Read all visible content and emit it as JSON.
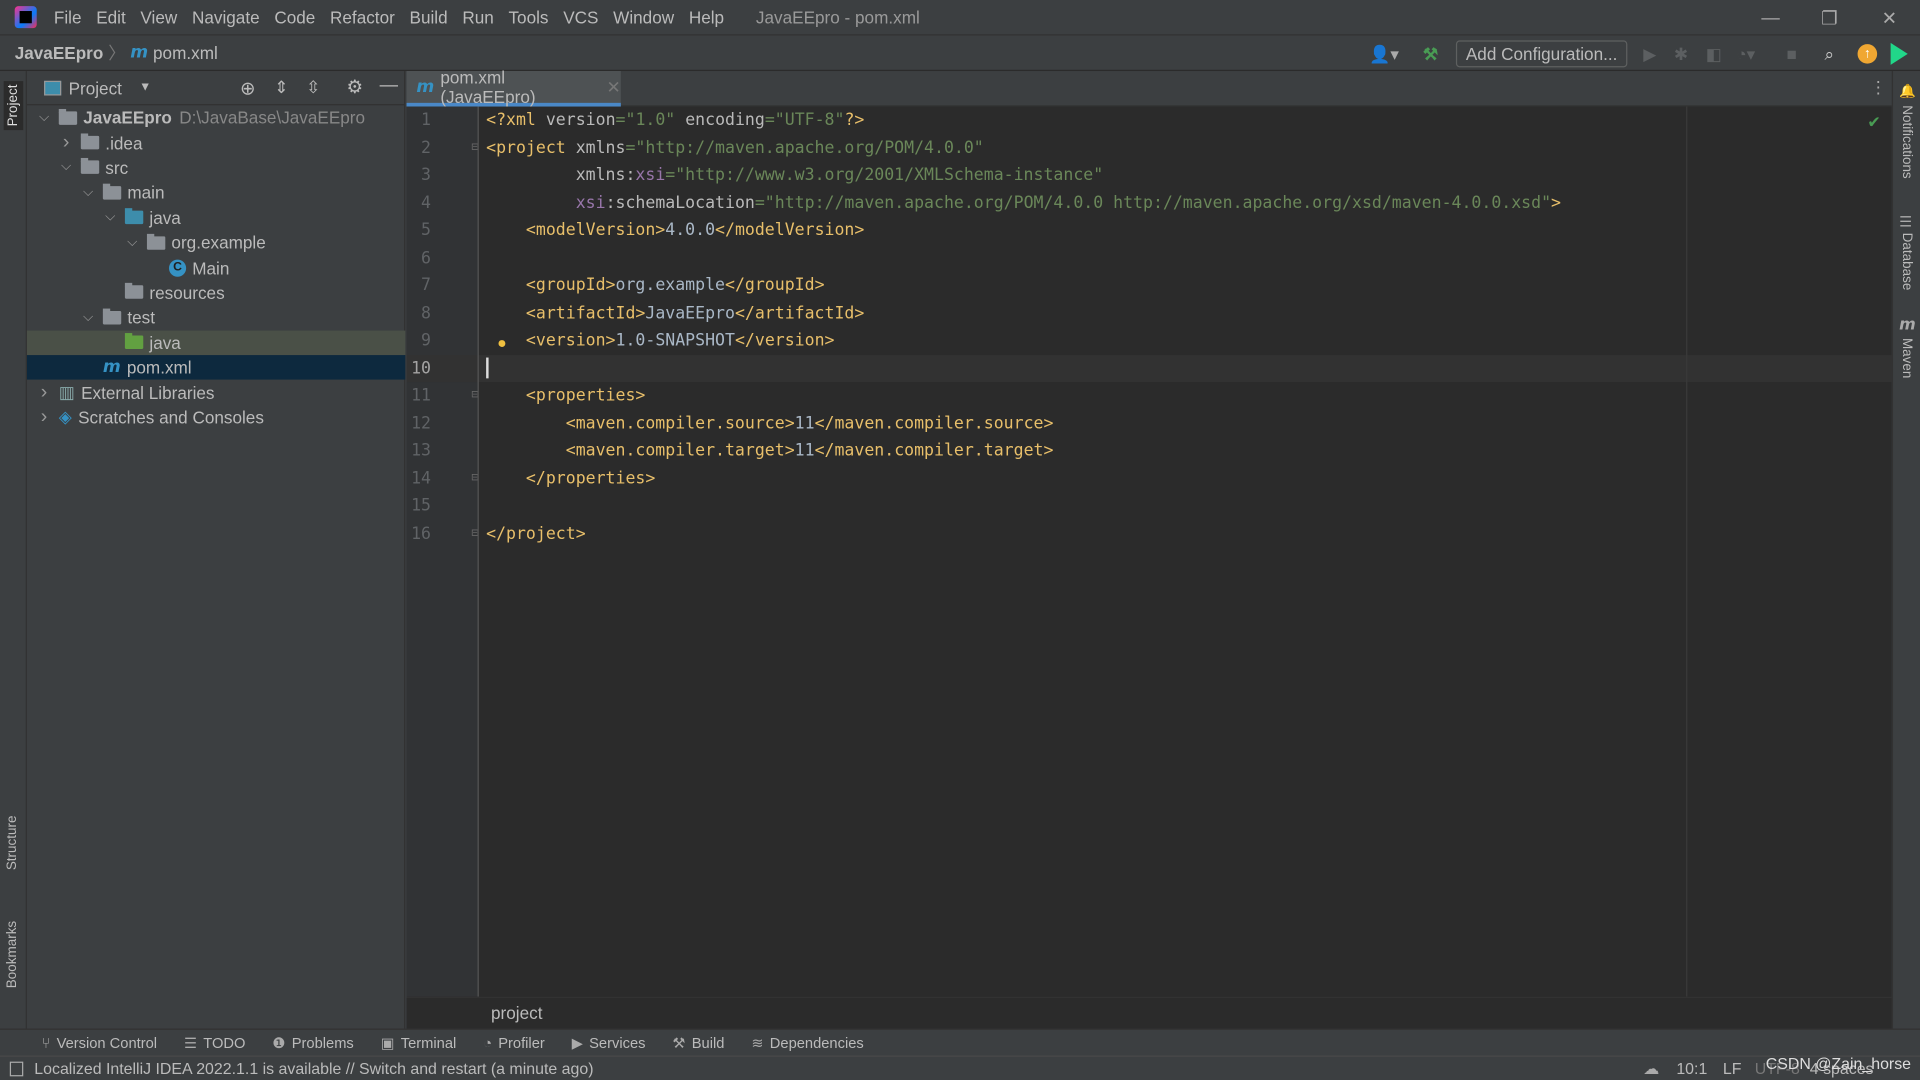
{
  "menubar": {
    "items": [
      "File",
      "Edit",
      "View",
      "Navigate",
      "Code",
      "Refactor",
      "Build",
      "Run",
      "Tools",
      "VCS",
      "Window",
      "Help"
    ],
    "title": "JavaEEpro - pom.xml"
  },
  "navbar": {
    "project": "JavaEEpro",
    "file": "pom.xml",
    "file_icon": "m",
    "add_configuration": "Add Configuration..."
  },
  "left_stripe": {
    "project": "Project",
    "structure": "Structure",
    "bookmarks": "Bookmarks"
  },
  "right_stripe": {
    "notifications": "Notifications",
    "database": "Database",
    "maven": "Maven"
  },
  "project_panel": {
    "title": "Project",
    "tree": [
      {
        "label": "JavaEEpro",
        "hint": "D:\\JavaBase\\JavaEEpro",
        "depth": 0,
        "chev": "v",
        "icon": "module",
        "bold": true
      },
      {
        "label": ".idea",
        "depth": 1,
        "chev": ">",
        "icon": "folder"
      },
      {
        "label": "src",
        "depth": 1,
        "chev": "v",
        "icon": "folder"
      },
      {
        "label": "main",
        "depth": 2,
        "chev": "v",
        "icon": "folder"
      },
      {
        "label": "java",
        "depth": 3,
        "chev": "v",
        "icon": "folder-blue"
      },
      {
        "label": "org.example",
        "depth": 4,
        "chev": "v",
        "icon": "package"
      },
      {
        "label": "Main",
        "depth": 5,
        "chev": "",
        "icon": "class"
      },
      {
        "label": "resources",
        "depth": 3,
        "chev": "",
        "icon": "resources"
      },
      {
        "label": "test",
        "depth": 2,
        "chev": "v",
        "icon": "folder"
      },
      {
        "label": "java",
        "depth": 3,
        "chev": "",
        "icon": "folder-green",
        "state": "hl"
      },
      {
        "label": "pom.xml",
        "depth": 2,
        "chev": "",
        "icon": "maven",
        "state": "sel"
      },
      {
        "label": "External Libraries",
        "depth": 0,
        "chev": ">",
        "icon": "library"
      },
      {
        "label": "Scratches and Consoles",
        "depth": 0,
        "chev": ">",
        "icon": "scratch"
      }
    ]
  },
  "editor": {
    "tab": "pom.xml (JavaEEpro)",
    "current_line": 10,
    "breadcrumb": "project",
    "lines": [
      [
        [
          "tag",
          "<?xml "
        ],
        [
          "attr",
          "version"
        ],
        [
          "val",
          "=\"1.0\" "
        ],
        [
          "attr",
          "encoding"
        ],
        [
          "val",
          "=\"UTF-8\""
        ],
        [
          "tag",
          "?>"
        ]
      ],
      [
        [
          "tag",
          "<project "
        ],
        [
          "attr",
          "xmlns"
        ],
        [
          "val",
          "=\"http://maven.apache.org/POM/4.0.0\""
        ]
      ],
      [
        [
          "attr",
          "         xmlns:"
        ],
        [
          "ns",
          "xsi"
        ],
        [
          "val",
          "=\"http://www.w3.org/2001/XMLSchema-instance\""
        ]
      ],
      [
        [
          "ns",
          "         xsi"
        ],
        [
          "attr",
          ":schemaLocation"
        ],
        [
          "val",
          "=\"http://maven.apache.org/POM/4.0.0 http://maven.apache.org/xsd/maven-4.0.0.xsd\""
        ],
        [
          "tag",
          ">"
        ]
      ],
      [
        [
          "tag",
          "    <modelVersion>"
        ],
        [
          "text",
          "4.0.0"
        ],
        [
          "tag",
          "</modelVersion>"
        ]
      ],
      [],
      [
        [
          "tag",
          "    <groupId>"
        ],
        [
          "text",
          "org.example"
        ],
        [
          "tag",
          "</groupId>"
        ]
      ],
      [
        [
          "tag",
          "    <artifactId>"
        ],
        [
          "text",
          "JavaEEpro"
        ],
        [
          "tag",
          "</artifactId>"
        ]
      ],
      [
        [
          "tag",
          "    <version>"
        ],
        [
          "text",
          "1.0-SNAPSHOT"
        ],
        [
          "tag",
          "</version>"
        ]
      ],
      [],
      [
        [
          "tag",
          "    <properties>"
        ]
      ],
      [
        [
          "tag",
          "        <maven.compiler.source>"
        ],
        [
          "text",
          "11"
        ],
        [
          "tag",
          "</maven.compiler.source>"
        ]
      ],
      [
        [
          "tag",
          "        <maven.compiler.target>"
        ],
        [
          "text",
          "11"
        ],
        [
          "tag",
          "</maven.compiler.target>"
        ]
      ],
      [
        [
          "tag",
          "    </properties>"
        ]
      ],
      [],
      [
        [
          "tag",
          "</project>"
        ]
      ]
    ]
  },
  "tool_windows": [
    "Version Control",
    "TODO",
    "Problems",
    "Terminal",
    "Profiler",
    "Services",
    "Build",
    "Dependencies"
  ],
  "status": {
    "message": "Localized IntelliJ IDEA 2022.1.1 is available // Switch and restart (a minute ago)",
    "position": "10:1",
    "line_sep": "LF",
    "encoding": "UTF-8",
    "indent": "4 spaces",
    "watermark": "CSDN @Zain_horse"
  },
  "colors": {
    "tag": "#e8bf6a",
    "attr": "#bababa",
    "value": "#6a8759",
    "namespace": "#9876aa",
    "text": "#a9b7c6",
    "accent": "#4a88c7"
  }
}
